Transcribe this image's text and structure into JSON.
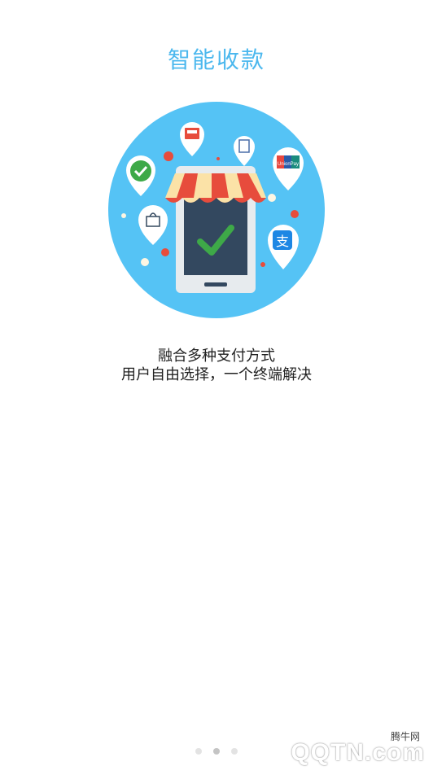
{
  "page": {
    "title": "智能收款",
    "description_line1": "融合多种支付方式",
    "description_line2": "用户自由选择，一个终端解决"
  },
  "illustration": {
    "icons": [
      "wechat-pay-icon",
      "cash-register-icon",
      "receipt-icon",
      "unionpay-icon",
      "shopping-bag-icon",
      "alipay-icon",
      "checkmark-icon",
      "store-awning"
    ],
    "unionpay_label": "UnionPay",
    "alipay_glyph": "支"
  },
  "pager": {
    "total": 3,
    "active_index": 1
  },
  "watermark": {
    "brand_text": "腾牛网",
    "logo_text": "QQTN.com"
  },
  "colors": {
    "accent": "#4cb8ee",
    "circle": "#55c3f5",
    "check": "#3ea948"
  }
}
